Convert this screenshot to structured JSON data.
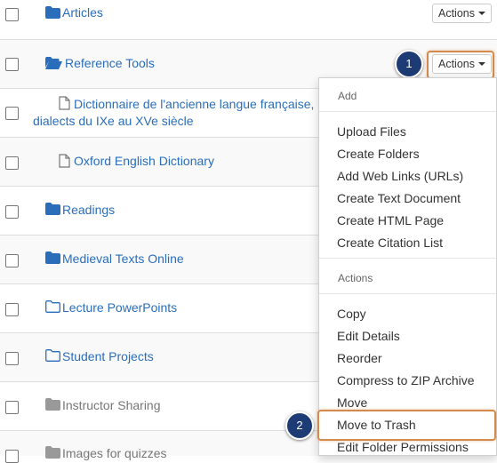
{
  "rows": [
    {
      "label": "Articles",
      "actions_label": "Actions"
    },
    {
      "label": "Reference Tools",
      "actions_label": "Actions"
    },
    {
      "label_line1": "Dictionnaire de l'ancienne langue française,",
      "label_line2": "dialects du IXe au XVe siècle"
    },
    {
      "label": "Oxford English Dictionary"
    },
    {
      "label": "Readings"
    },
    {
      "label": "Medieval Texts Online"
    },
    {
      "label": "Lecture PowerPoints"
    },
    {
      "label": "Student Projects"
    },
    {
      "label": "Instructor Sharing"
    },
    {
      "label": "Images for quizzes"
    }
  ],
  "callouts": {
    "step1": "1",
    "step2": "2"
  },
  "menu": {
    "add_header": "Add",
    "add_items": [
      "Upload Files",
      "Create Folders",
      "Add Web Links (URLs)",
      "Create Text Document",
      "Create HTML Page",
      "Create Citation List"
    ],
    "actions_header": "Actions",
    "actions_items": [
      "Copy",
      "Edit Details",
      "Reorder",
      "Compress to ZIP Archive",
      "Move",
      "Move to Trash",
      "Edit Folder Permissions"
    ]
  },
  "colors": {
    "link": "#2a6ebb",
    "folder": "#2a6ebb",
    "muted": "#777777",
    "highlight": "#d38a4a",
    "step_badge": "#1d3b74"
  }
}
